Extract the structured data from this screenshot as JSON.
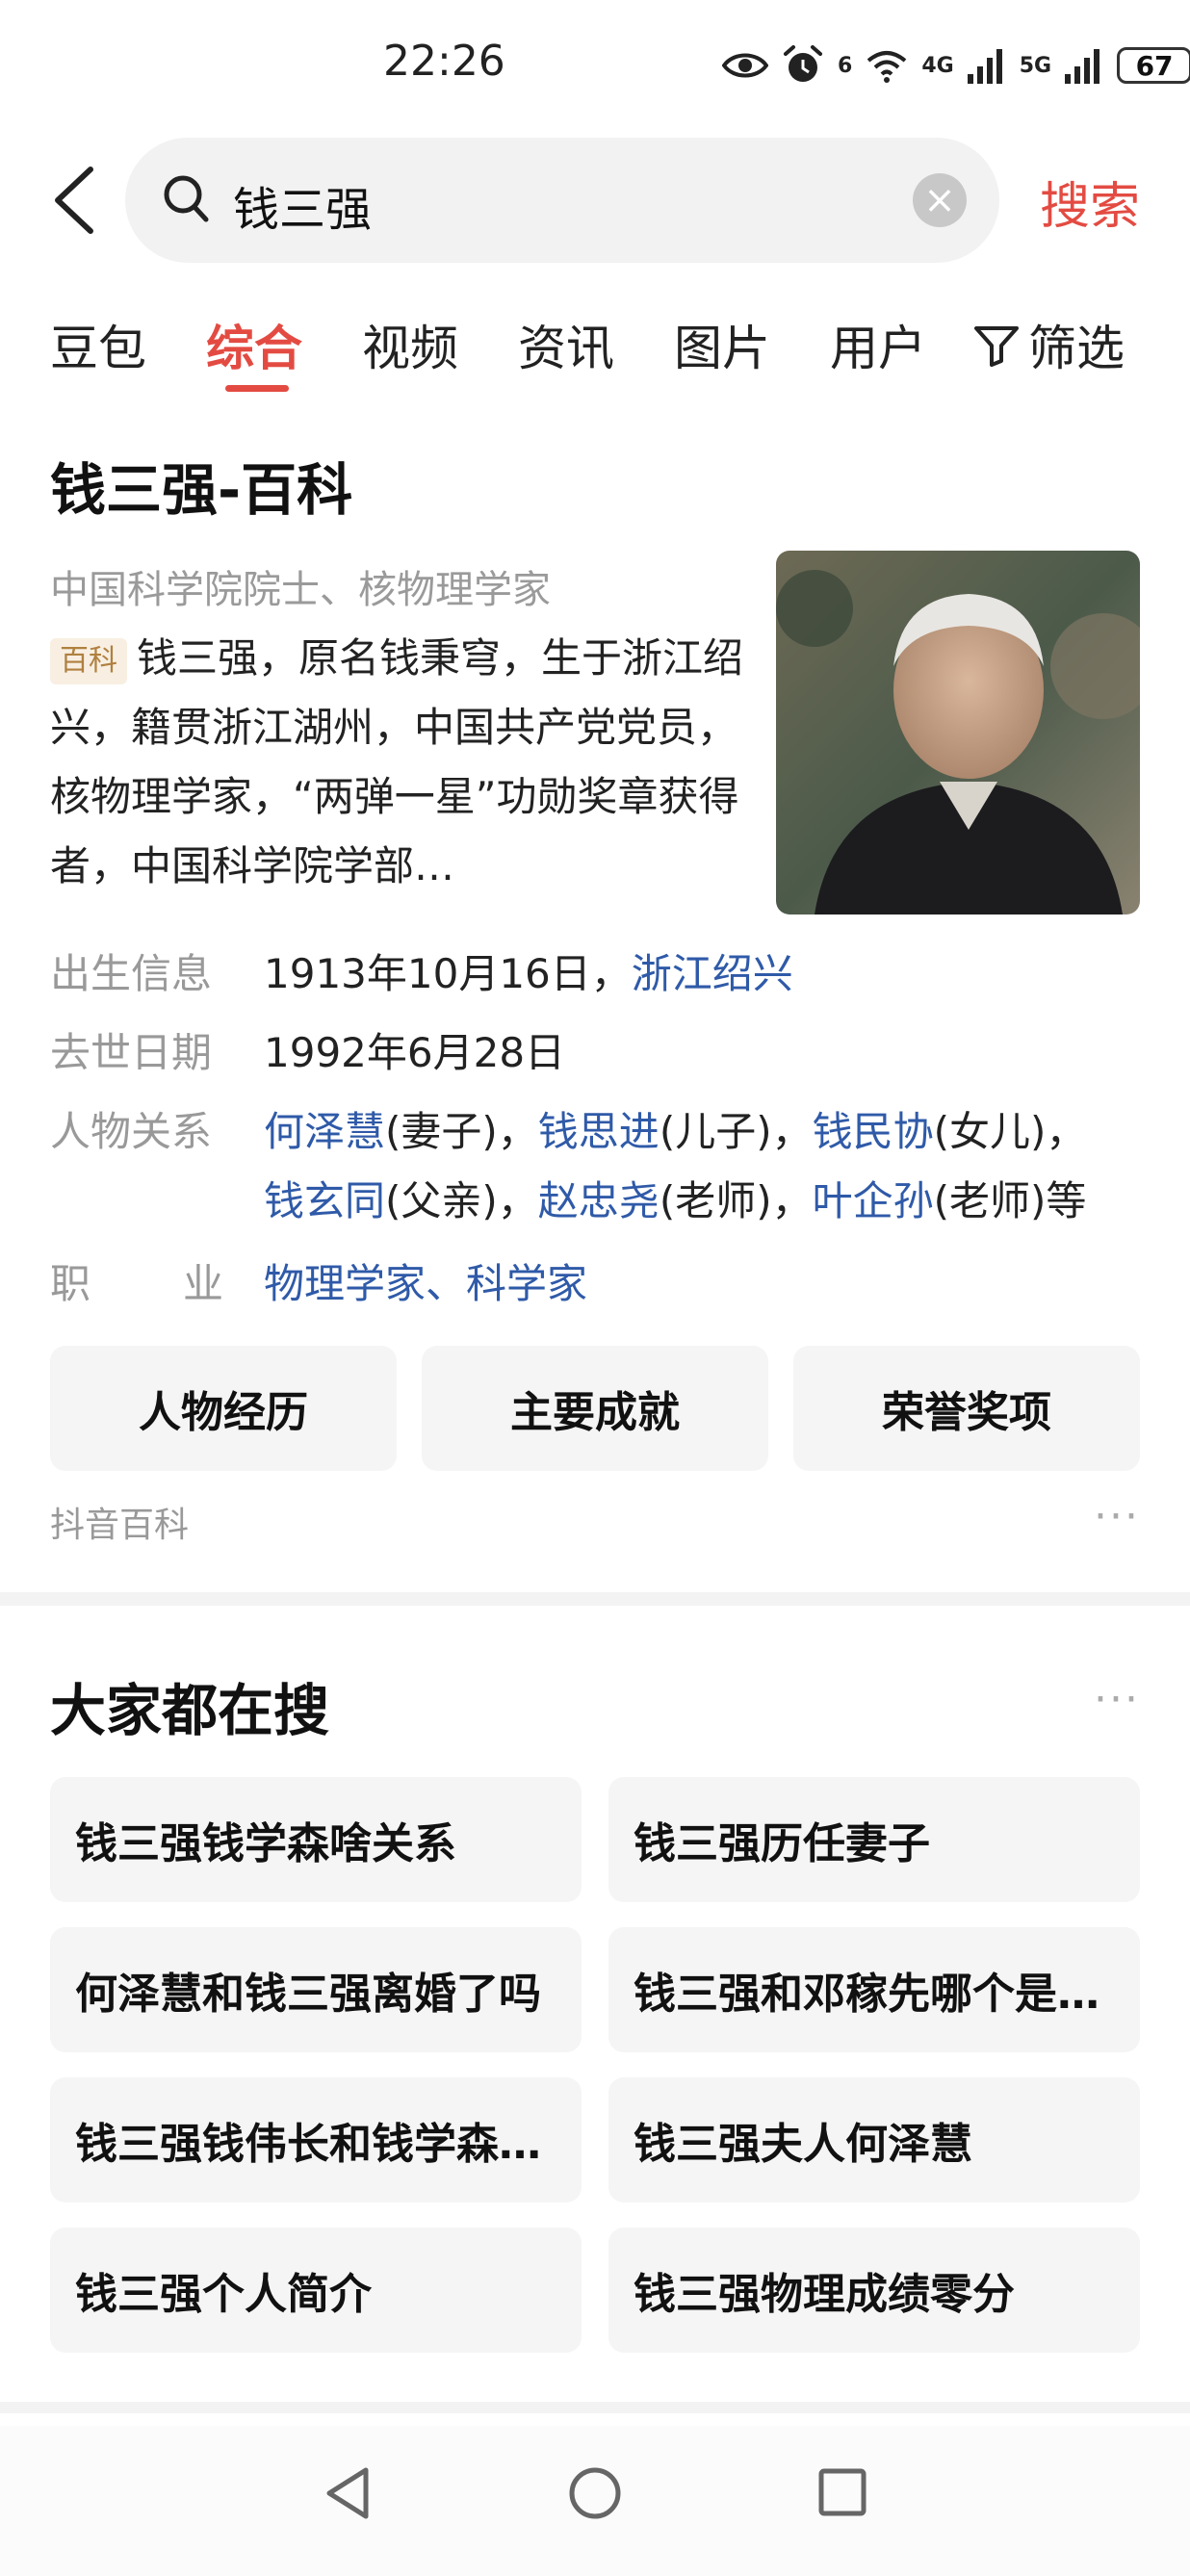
{
  "status_bar": {
    "time": "22:26",
    "wifi_label": "6",
    "net_4g": "4G",
    "net_5g": "5G",
    "battery": "67"
  },
  "search": {
    "query": "钱三强",
    "button_label": "搜索"
  },
  "tabs": [
    {
      "label": "豆包"
    },
    {
      "label": "综合"
    },
    {
      "label": "视频"
    },
    {
      "label": "资讯"
    },
    {
      "label": "图片"
    },
    {
      "label": "用户"
    },
    {
      "label": "筛选"
    }
  ],
  "baike": {
    "title": "钱三强-百科",
    "subtitle": "中国科学院院士、核物理学家",
    "tag": "百科",
    "summary": "钱三强，原名钱秉穹，生于浙江绍兴，籍贯浙江湖州，中国共产党党员，核物理学家，“两弹一星”功勋奖章获得者，中国科学院学部…",
    "birth": {
      "label": "出生信息",
      "date": "1913年10月16日，",
      "place": "浙江绍兴"
    },
    "death": {
      "label": "去世日期",
      "date": "1992年6月28日"
    },
    "relations": {
      "label": "人物关系",
      "r1_name": "何泽慧",
      "r1_rel": "(妻子)，",
      "r2_name": "钱思进",
      "r2_rel": "(儿子)，",
      "r3_name": "钱民协",
      "r3_rel": "(女儿)，",
      "r4_name": "钱玄同",
      "r4_rel": "(父亲)，",
      "r5_name": "赵忠尧",
      "r5_rel": "(老师)，",
      "r6_name": "叶企孙",
      "r6_rel": "(老师)等"
    },
    "occupation": {
      "label_1": "职",
      "label_2": "业",
      "o1": "物理学家",
      "sep": "、",
      "o2": "科学家"
    },
    "buttons": [
      "人物经历",
      "主要成就",
      "荣誉奖项"
    ],
    "source": "抖音百科"
  },
  "popular": {
    "title": "大家都在搜",
    "items": [
      "钱三强钱学森啥关系",
      "钱三强历任妻子",
      "何泽慧和钱三强离婚了吗",
      "钱三强和邓稼先哪个是…",
      "钱三强钱伟长和钱学森…",
      "钱三强夫人何泽慧",
      "钱三强个人简介",
      "钱三强物理成绩零分"
    ]
  },
  "colors": {
    "accent": "#e34b42",
    "link": "#2f5aa8"
  }
}
